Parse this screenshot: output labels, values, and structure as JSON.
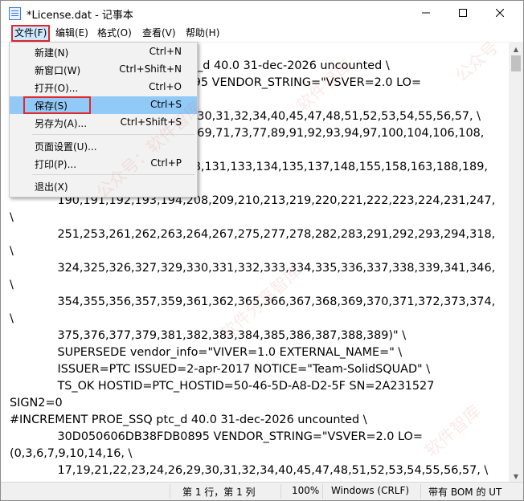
{
  "window": {
    "title": "*License.dat - 记事本",
    "controls": {
      "minimize": "—",
      "maximize": "☐",
      "close": "✕"
    }
  },
  "menubar": [
    "文件(F)",
    "编辑(E)",
    "格式(O)",
    "查看(V)",
    "帮助(H)"
  ],
  "file_menu": {
    "items": [
      {
        "label": "新建(N)",
        "shortcut": "Ctrl+N"
      },
      {
        "label": "新窗口(W)",
        "shortcut": "Ctrl+Shift+N"
      },
      {
        "label": "打开(O)...",
        "shortcut": "Ctrl+O"
      },
      {
        "label": "保存(S)",
        "shortcut": "Ctrl+S",
        "highlighted": true
      },
      {
        "label": "另存为(A)...",
        "shortcut": "Ctrl+Shift+S"
      },
      {
        "label": "页面设置(U)...",
        "shortcut": ""
      },
      {
        "label": "打印(P)...",
        "shortcut": "Ctrl+P"
      },
      {
        "label": "退出(X)",
        "shortcut": ""
      }
    ]
  },
  "editor_lines": [
    "                                              ptc_d 40.0 31-dec-2026 uncounted \\",
    "                                              0895 VENDOR_STRING=\"VSVER=2.0 LO=",
    "",
    "                                              29,30,31,32,34,40,45,47,48,51,52,53,54,55,56,57, \\",
    "                                              67,69,71,73,77,89,91,92,93,94,97,100,104,106,108,",
    "",
    "                                              128,131,133,134,135,137,148,155,158,163,188,189,",
    "",
    "             190,191,192,193,194,208,209,210,213,219,220,221,222,223,224,231,247,",
    "\\",
    "             251,253,261,262,263,264,267,275,277,278,282,283,291,292,293,294,318,",
    "\\",
    "             324,325,326,327,329,330,331,332,333,334,335,336,337,338,339,341,346,",
    "\\",
    "             354,355,356,357,359,361,362,365,366,367,368,369,370,371,372,373,374,",
    "\\",
    "             375,376,377,379,381,382,383,384,385,386,387,388,389)\" \\",
    "             SUPERSEDE vendor_info=\"VIVER=1.0 EXTERNAL_NAME=\" \\",
    "             ISSUER=PTC ISSUED=2-apr-2017 NOTICE=\"Team-SolidSQUAD\" \\",
    "             TS_OK HOSTID=PTC_HOSTID=50-46-5D-A8-D2-5F SN=2A231527",
    "SIGN2=0",
    "#INCREMENT PROE_SSQ ptc_d 40.0 31-dec-2026 uncounted \\",
    "             30D050606DB38FDB0895 VENDOR_STRING=\"VSVER=2.0 LO=",
    "(0,3,6,7,9,10,14,16, \\",
    "             17,19,21,22,23,24,26,29,30,31,32,34,40,45,47,48,51,52,53,54,55,56,57, \\"
  ],
  "status": {
    "position": "第 1 行，第 1 列",
    "zoom": "100%",
    "line_ending": "Windows (CRLF)",
    "encoding": "带有 BOM 的 UT"
  },
  "watermarks": [
    "公众号：软件智库",
    "软件智库",
    "公众号",
    "软件分享智库",
    "软件智库"
  ],
  "colors": {
    "highlight": "#91c9f7",
    "annotation": "#e0282e"
  }
}
